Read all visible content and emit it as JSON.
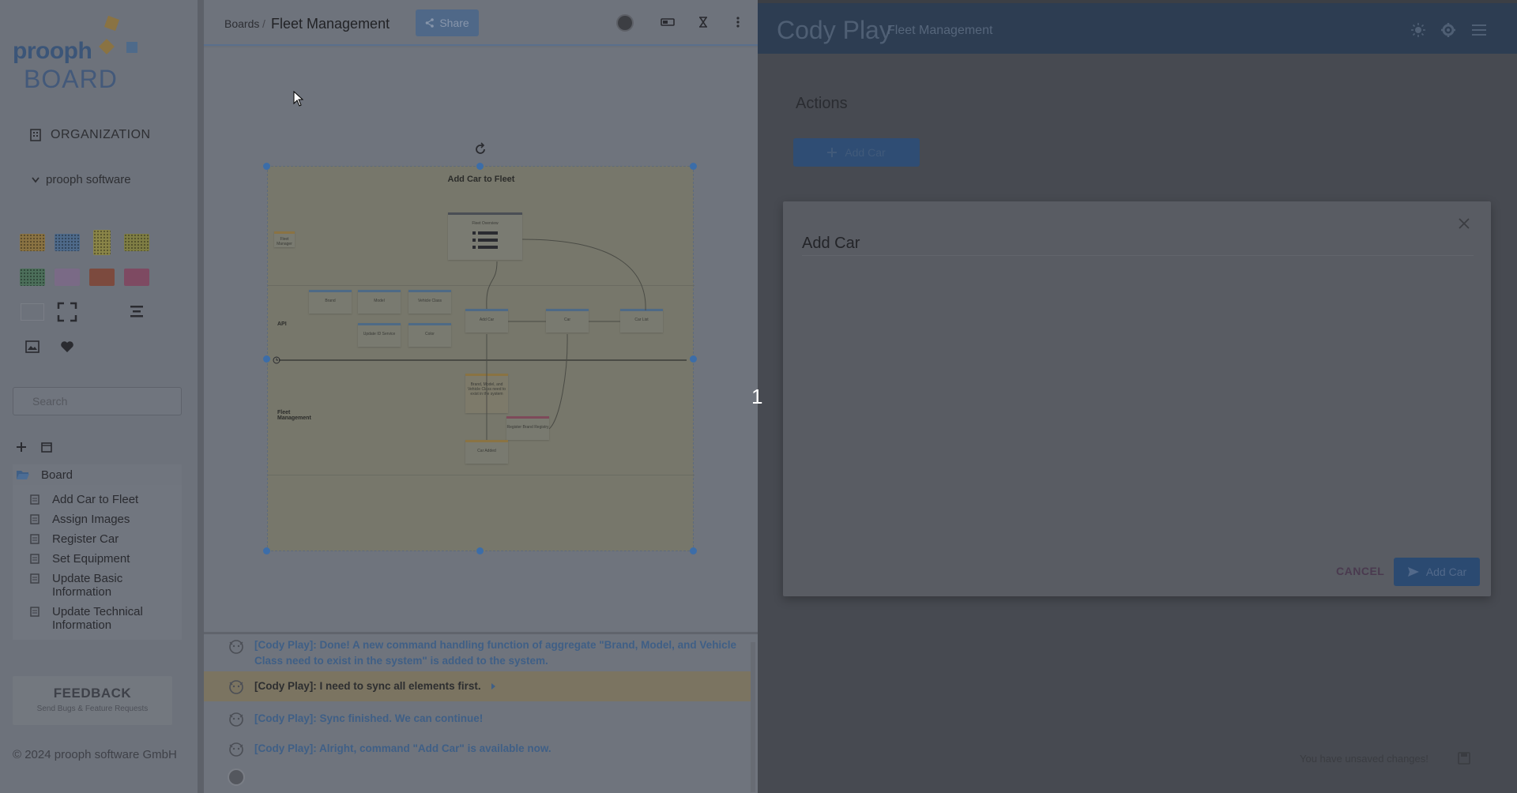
{
  "sidebar": {
    "logo_text_1": "prooph",
    "logo_text_2": "BOARD",
    "org_label": "ORGANIZATION",
    "org_name": "prooph software",
    "search_placeholder": "Search",
    "tree_root": "Board",
    "tree_items": [
      {
        "line1": "Add Car to Fleet",
        "line2": ""
      },
      {
        "line1": "Assign Images",
        "line2": ""
      },
      {
        "line1": "Register Car",
        "line2": ""
      },
      {
        "line1": "Set Equipment",
        "line2": ""
      },
      {
        "line1": "Update Basic",
        "line2": "Information"
      },
      {
        "line1": "Update Technical",
        "line2": "Information"
      }
    ],
    "feedback_title": "FEEDBACK",
    "feedback_sub": "Send Bugs & Feature Requests",
    "copyright": "© 2024 prooph software GmbH",
    "palette_colors": [
      "#8a7343",
      "#4e6a8a",
      "#8a8548",
      "#7f7e44",
      "#4c6f5a",
      "#7a6a86",
      "#7c4a3e",
      "#7e4a62"
    ]
  },
  "board": {
    "breadcrumb": "Boards",
    "separator": "/",
    "title": "Fleet Management",
    "share_label": "Share",
    "frame_title": "Add Car to Fleet",
    "lanes": [
      "API",
      "Fleet Management"
    ],
    "card_labels": [
      "Fleet Overview",
      "Brand",
      "Model",
      "Vehicle Class",
      "Add Car",
      "Car",
      "Car List",
      "Update ID Service",
      "Color",
      "Car Added",
      "Brand, Model, and Vehicle Class need to exist in the system",
      "Register Brand Registry",
      "Fleet Manager"
    ]
  },
  "chat": {
    "messages": [
      {
        "text": "[Cody Play]: Done! A new command handling function of aggregate \"Brand, Model, and Vehicle Class need to exist in the system\" is added to the system.",
        "highlight": false
      },
      {
        "text": "[Cody Play]: I need to sync all elements first.",
        "highlight": true
      },
      {
        "text": "[Cody Play]: Sync finished. We can continue!",
        "highlight": false
      },
      {
        "text": "[Cody Play]: Alright, command \"Add Car\" is available now.",
        "highlight": false
      }
    ]
  },
  "play": {
    "title": "Cody Play",
    "subtitle": "Fleet Management",
    "actions_label": "Actions",
    "add_car_action": "Add Car",
    "dialog_title": "Add Car",
    "cancel_label": "CANCEL",
    "submit_label": "Add Car",
    "unsaved_text": "You have unsaved changes!"
  },
  "overlay": {
    "page_number": "1"
  }
}
